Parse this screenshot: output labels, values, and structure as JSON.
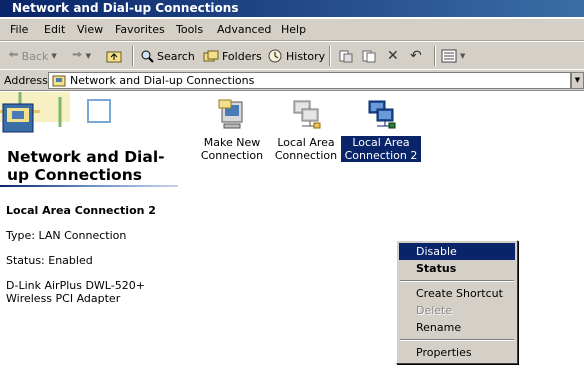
{
  "window": {
    "title": "Network and Dial-up Connections"
  },
  "menu": [
    "File",
    "Edit",
    "View",
    "Favorites",
    "Tools",
    "Advanced",
    "Help"
  ],
  "toolbar": {
    "back": "Back",
    "search": "Search",
    "folders": "Folders",
    "history": "History"
  },
  "address": {
    "label": "Address",
    "value": "Network and Dial-up Connections"
  },
  "webview": {
    "title": "Network and Dial-up Connections",
    "selected_name": "Local Area Connection 2",
    "type": "Type: LAN Connection",
    "status": "Status: Enabled",
    "device": "D-Link AirPlus DWL-520+ Wireless PCI Adapter"
  },
  "items": [
    {
      "label": "Make New Connection",
      "icon": "make-new-connection-icon"
    },
    {
      "label": "Local Area Connection",
      "icon": "network-connection-icon"
    },
    {
      "label": "Local Area Connection 2",
      "icon": "network-connection-icon",
      "selected": true
    }
  ],
  "context_menu": {
    "disable": "Disable",
    "status": "Status",
    "create_shortcut": "Create Shortcut",
    "delete": "Delete",
    "rename": "Rename",
    "properties": "Properties"
  },
  "colors": {
    "titlebar": "#0a246a",
    "selection": "#0a246a",
    "chrome": "#d4d0c8"
  }
}
